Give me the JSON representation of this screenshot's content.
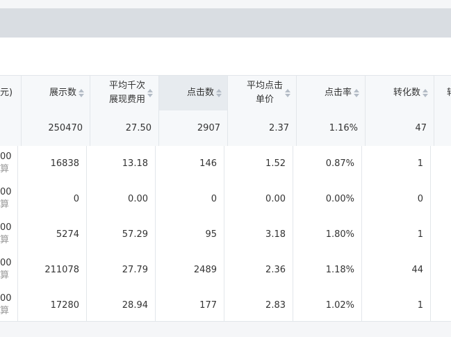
{
  "header": {
    "clipped_first_col": "元)",
    "columns": [
      {
        "l1": "展示数",
        "l2": ""
      },
      {
        "l1": "平均千次",
        "l2": "展现费用"
      },
      {
        "l1": "点击数",
        "l2": ""
      },
      {
        "l1": "平均点击",
        "l2": "单价"
      },
      {
        "l1": "点击率",
        "l2": ""
      },
      {
        "l1": "转化数",
        "l2": ""
      },
      {
        "l1": "转",
        "l2": ""
      }
    ]
  },
  "summary": {
    "values": [
      "250470",
      "27.50",
      "2907",
      "2.37",
      "1.16%",
      "47"
    ]
  },
  "rows": [
    {
      "first_top": "00",
      "first_bottom": "算",
      "values": [
        "16838",
        "13.18",
        "146",
        "1.52",
        "0.87%",
        "1"
      ]
    },
    {
      "first_top": "00",
      "first_bottom": "算",
      "values": [
        "0",
        "0.00",
        "0",
        "0.00",
        "0.00%",
        "0"
      ]
    },
    {
      "first_top": "00",
      "first_bottom": "算",
      "values": [
        "5274",
        "57.29",
        "95",
        "3.18",
        "1.80%",
        "1"
      ]
    },
    {
      "first_top": "00",
      "first_bottom": "算",
      "values": [
        "211078",
        "27.79",
        "2489",
        "2.36",
        "1.18%",
        "44"
      ]
    },
    {
      "first_top": "00",
      "first_bottom": "算",
      "values": [
        "17280",
        "28.94",
        "177",
        "2.83",
        "1.02%",
        "1"
      ]
    }
  ]
}
